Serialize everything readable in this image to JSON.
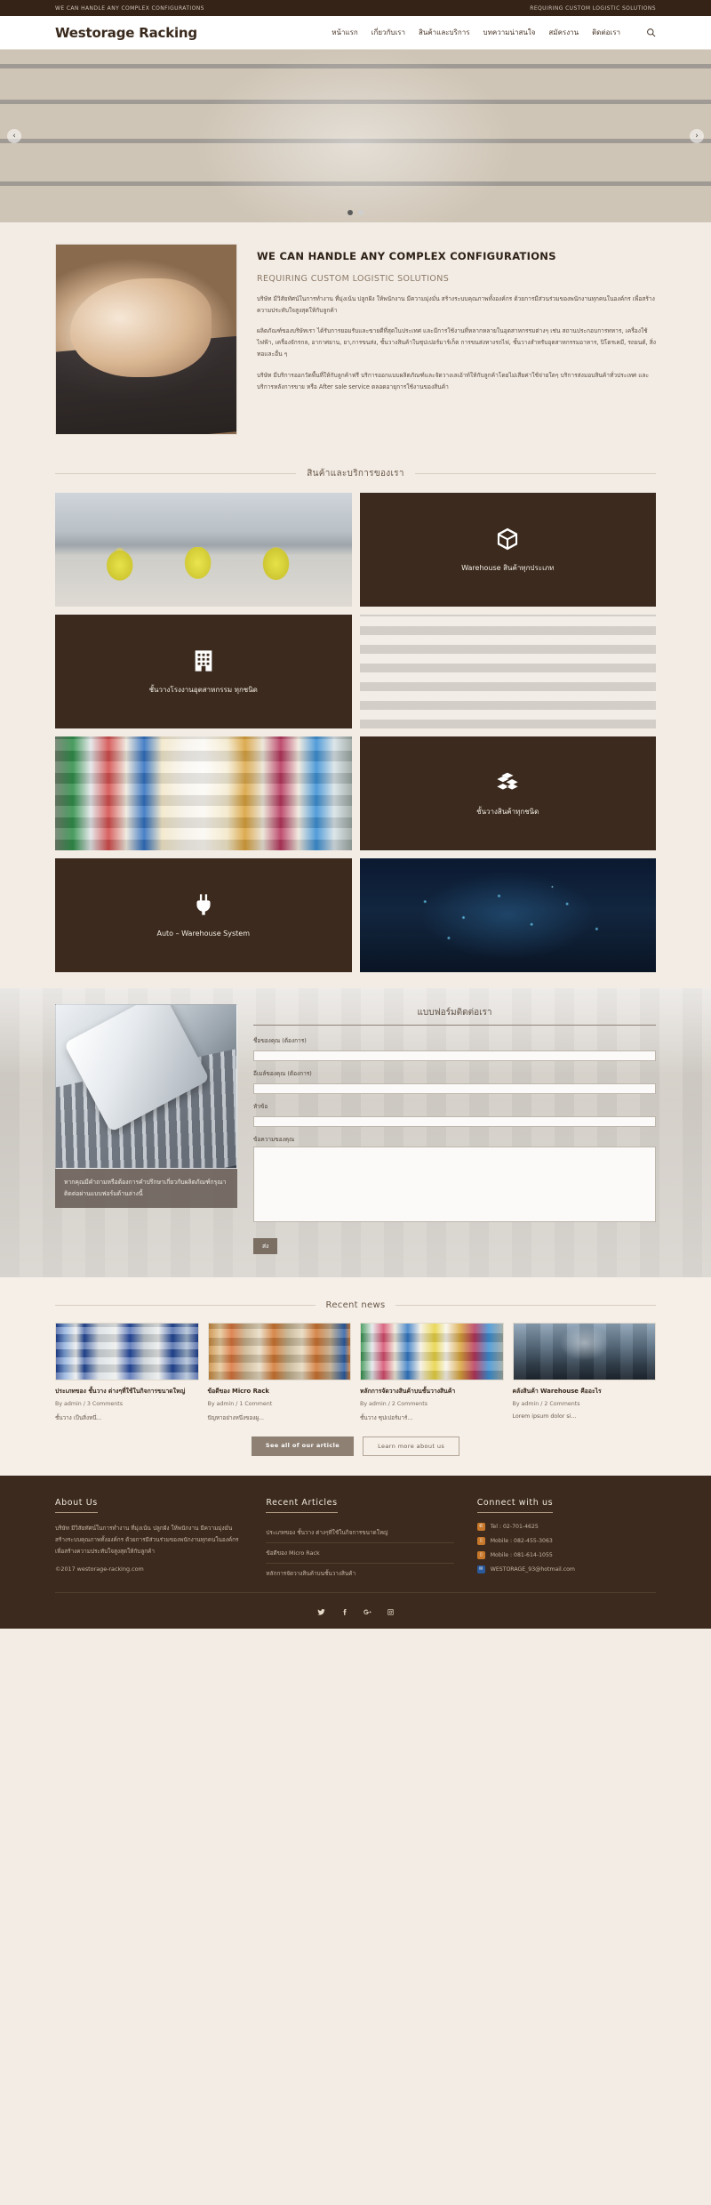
{
  "topbar": {
    "left": "WE CAN HANDLE ANY COMPLEX CONFIGURATIONS",
    "right": "REQUIRING CUSTOM LOGISTIC SOLUTIONS"
  },
  "header": {
    "brand": "Westorage Racking",
    "nav": [
      {
        "label": "หน้าแรก"
      },
      {
        "label": "เกี่ยวกับเรา"
      },
      {
        "label": "สินค้าและบริการ"
      },
      {
        "label": "บทความน่าสนใจ"
      },
      {
        "label": "สมัครงาน"
      },
      {
        "label": "ติดต่อเรา"
      }
    ],
    "search_icon": "search-icon"
  },
  "hero": {
    "prev_label": "‹",
    "next_label": "›",
    "dots": 2,
    "active_dot": 0
  },
  "intro": {
    "heading": "WE CAN HANDLE ANY COMPLEX CONFIGURATIONS",
    "subheading": "REQUIRING CUSTOM LOGISTIC SOLUTIONS",
    "p1": "บริษัท มีวิสัยทัศน์ในการทำงาน ที่มุ่งเน้น ปลูกฝัง ให้พนักงาน มีความมุ่งมั่น สร้างระบบคุณภาพทั้งองค์กร ด้วยการมีส่วนร่วมของพนักงานทุกคนในองค์กร เพื่อสร้างความประทับใจสูงสุดให้กับลูกค้า",
    "p2": "ผลิตภัณฑ์ของบริษัทเรา ได้รับการยอมรับและขายดีที่สุดในประเทศ และมีการใช้งานที่หลากหลายในอุตสาหกรรมต่างๆ เช่น สถานประกอบการทหาร, เครื่องใช้ไฟฟ้า, เครื่องจักรกล, อากาศยาน, ยา,การขนส่ง, ชั้นวางสินค้าในซุปเปอร์มาร์เก็ต การขนส่งทางรถไฟ, ชั้นวางสำหรับอุตสาหกรรมอาหาร, ปิโตรเคมี, รถยนต์, สิ่งทอและอื่น ๆ",
    "p3": "บริษัท มีบริการออกวัดพื้นที่ให้กับลูกค้าฟรี บริการออกแบบผลิตภัณฑ์และจัดวางเลเอ้าท์ให้กับลูกค้าโดยไม่เสียค่าใช้จ่ายใดๆ บริการส่งมอบสินค้าทั่วประเทศ และบริการหลังการขาย หรือ After sale service ตลอดอายุการใช้งานของสินค้า"
  },
  "services": {
    "title": "สินค้าและบริการของเรา",
    "cards": [
      {
        "type": "photo",
        "photo": "ph1",
        "label": "",
        "icon": ""
      },
      {
        "type": "dark",
        "photo": "",
        "label": "Warehouse สินค้าทุกประเภท",
        "icon": "cube-icon"
      },
      {
        "type": "dark",
        "photo": "",
        "label": "ชั้นวางโรงงานอุตสาหกรรม ทุกชนิด",
        "icon": "building-icon"
      },
      {
        "type": "photo",
        "photo": "ph2",
        "label": "",
        "icon": ""
      },
      {
        "type": "photo",
        "photo": "ph3",
        "label": "",
        "icon": ""
      },
      {
        "type": "dark",
        "photo": "",
        "label": "ชั้นวางสินค้าทุกชนิด",
        "icon": "boxes-icon"
      },
      {
        "type": "dark",
        "photo": "",
        "label": "Auto – Warehouse System",
        "icon": "plug-icon"
      },
      {
        "type": "photo",
        "photo": "ph4",
        "label": "",
        "icon": ""
      }
    ]
  },
  "contact": {
    "caption": "หากคุณมีคำถามหรือต้องการคำปรึกษาเกี่ยวกับผลิตภัณฑ์กรุณาติดต่อผ่านแบบฟอร์มด้านล่างนี้",
    "heading": "แบบฟอร์มติดต่อเรา",
    "fields": [
      {
        "label": "ชื่อของคุณ (ต้องการ)",
        "value": "",
        "type": "text",
        "name": "name-field"
      },
      {
        "label": "อีเมล์ของคุณ (ต้องการ)",
        "value": "",
        "type": "text",
        "name": "email-field"
      },
      {
        "label": "หัวข้อ",
        "value": "",
        "type": "text",
        "name": "subject-field"
      },
      {
        "label": "ข้อความของคุณ",
        "value": "",
        "type": "textarea",
        "name": "message-field"
      }
    ],
    "send_label": "ส่ง"
  },
  "news": {
    "title": "Recent news",
    "items": [
      {
        "thumb": "nt1",
        "title": "ประเภทของ ชั้นวาง ต่างๆที่ใช้ในกิจการขนาดใหญ่",
        "meta": "By admin / 3 Comments",
        "excerpt": "ชั้นวาง เป็นสิ่งหนึ่..."
      },
      {
        "thumb": "nt2",
        "title": "ข้อดีของ Micro Rack",
        "meta": "By admin / 1 Comment",
        "excerpt": "ปัญหาอย่างหนึ่งของผู..."
      },
      {
        "thumb": "nt3",
        "title": "หลักการจัดวางสินค้าบนชั้นวางสินค้า",
        "meta": "By admin / 2 Comments",
        "excerpt": "ชั้นวาง ซุปเปอร์มาร์..."
      },
      {
        "thumb": "nt4",
        "title": "คลังสินค้า Warehouse คืออะไร",
        "meta": "By admin / 2 Comments",
        "excerpt": "Lorem ipsum dolor si..."
      }
    ],
    "btn_all": "See all of our article",
    "btn_more": "Learn more about us"
  },
  "footer": {
    "about": {
      "heading": "About Us",
      "text": "บริษัท มีวิสัยทัศน์ในการทำงาน ที่มุ่งเน้น ปลูกฝัง ให้พนักงาน มีความมุ่งมั่น สร้างระบบคุณภาพทั้งองค์กร ด้วยการมีส่วนร่วมของพนักงานทุกคนในองค์กร เพื่อสร้างความประทับใจสูงสุดให้กับลูกค้า",
      "copyright": "©2017 westorage-racking.com"
    },
    "articles": {
      "heading": "Recent Articles",
      "items": [
        {
          "label": "ประเภทของ ชั้นวาง ต่างๆที่ใช้ในกิจการขนาดใหญ่"
        },
        {
          "label": "ข้อดีของ Micro Rack"
        },
        {
          "label": "หลักการจัดวางสินค้าบนชั้นวางสินค้า"
        }
      ]
    },
    "connect": {
      "heading": "Connect with us",
      "items": [
        {
          "icon": "phone-icon",
          "label": "Tel : 02-701-4625"
        },
        {
          "icon": "mobile-icon",
          "label": "Mobile : 082-455-3063"
        },
        {
          "icon": "mobile-icon",
          "label": "Mobile : 081-614-1055"
        },
        {
          "icon": "mail-icon",
          "label": "WESTORAGE_93@hotmail.com"
        }
      ]
    },
    "social": [
      {
        "name": "twitter-icon"
      },
      {
        "name": "facebook-icon"
      },
      {
        "name": "google-plus-icon"
      },
      {
        "name": "instagram-icon"
      }
    ]
  }
}
